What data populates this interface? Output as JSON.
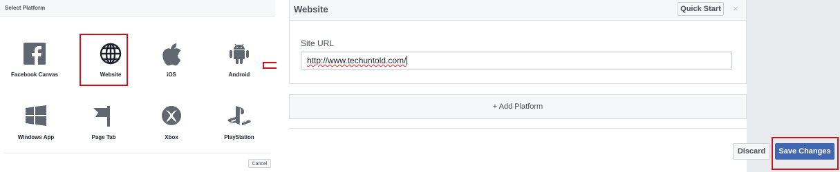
{
  "select_platform": {
    "title": "Select Platform",
    "platforms": [
      {
        "label": "Facebook Canvas",
        "icon": "facebook-icon"
      },
      {
        "label": "Website",
        "icon": "globe-icon",
        "selected": true
      },
      {
        "label": "iOS",
        "icon": "apple-icon"
      },
      {
        "label": "Android",
        "icon": "android-icon"
      },
      {
        "label": "Windows App",
        "icon": "windows-icon"
      },
      {
        "label": "Page Tab",
        "icon": "flag-icon"
      },
      {
        "label": "Xbox",
        "icon": "xbox-icon"
      },
      {
        "label": "PlayStation",
        "icon": "playstation-icon"
      }
    ],
    "cancel_label": "Cancel"
  },
  "website_card": {
    "title": "Website",
    "quick_start_label": "Quick Start",
    "close_glyph": "×",
    "site_url_label": "Site URL",
    "site_url_value": "http://www.techuntold.com/"
  },
  "add_platform_label": "+ Add Platform",
  "footer": {
    "discard_label": "Discard",
    "save_label": "Save Changes"
  },
  "colors": {
    "highlight": "#d0101a",
    "primary": "#4267b2",
    "icon": "#606770"
  }
}
